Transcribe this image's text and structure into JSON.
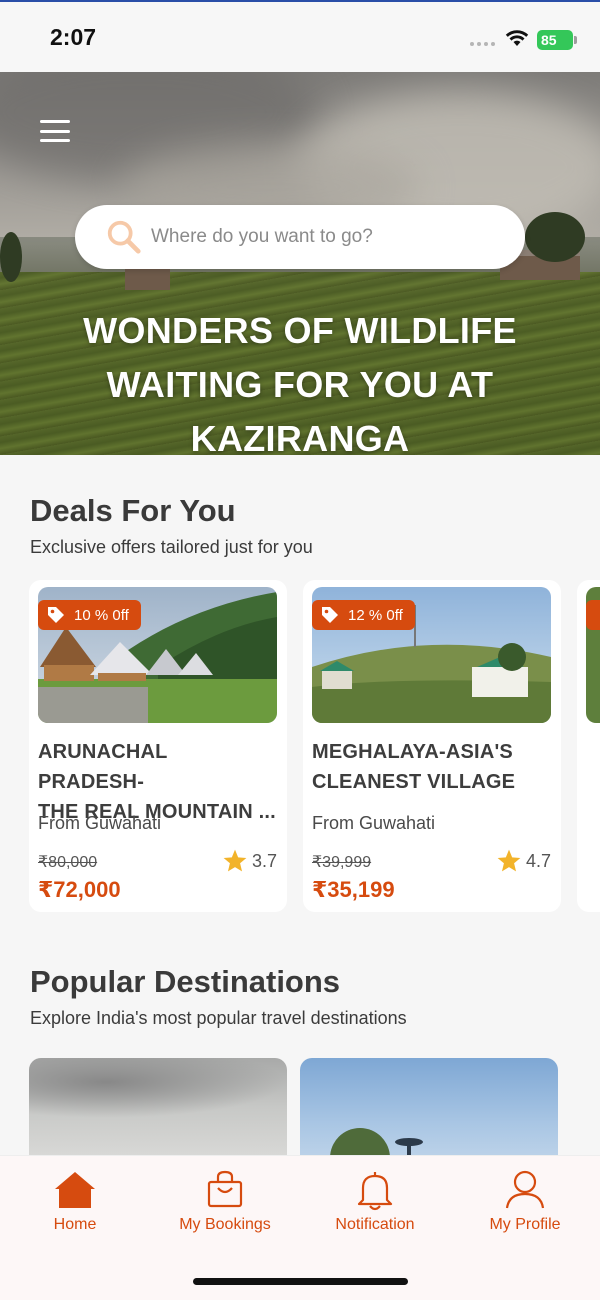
{
  "status_bar": {
    "time": "2:07",
    "battery": "85"
  },
  "search": {
    "placeholder": "Where do you want to go?"
  },
  "hero": {
    "title": "WONDERS OF WILDLIFE WAITING FOR YOU AT KAZIRANGA"
  },
  "deals": {
    "title": "Deals For You",
    "subtitle": "Exclusive offers tailored just for you",
    "items": [
      {
        "discount": "10 % 0ff",
        "title": "ARUNACHAL PRADESH-\nTHE REAL MOUNTAIN ...",
        "from": "From Guwahati",
        "old_price": "₹80,000",
        "price": "₹72,000",
        "rating": "3.7"
      },
      {
        "discount": "12 % 0ff",
        "title": "MEGHALAYA-ASIA'S\nCLEANEST VILLAGE",
        "from": "From Guwahati",
        "old_price": "₹39,999",
        "price": "₹35,199",
        "rating": "4.7"
      }
    ]
  },
  "popular": {
    "title": "Popular Destinations",
    "subtitle": "Explore India's most popular travel destinations"
  },
  "nav": {
    "home": "Home",
    "bookings": "My Bookings",
    "notification": "Notification",
    "profile": "My Profile"
  },
  "colors": {
    "accent": "#d64b0f",
    "star": "#f2b32a",
    "battery": "#34c759"
  }
}
